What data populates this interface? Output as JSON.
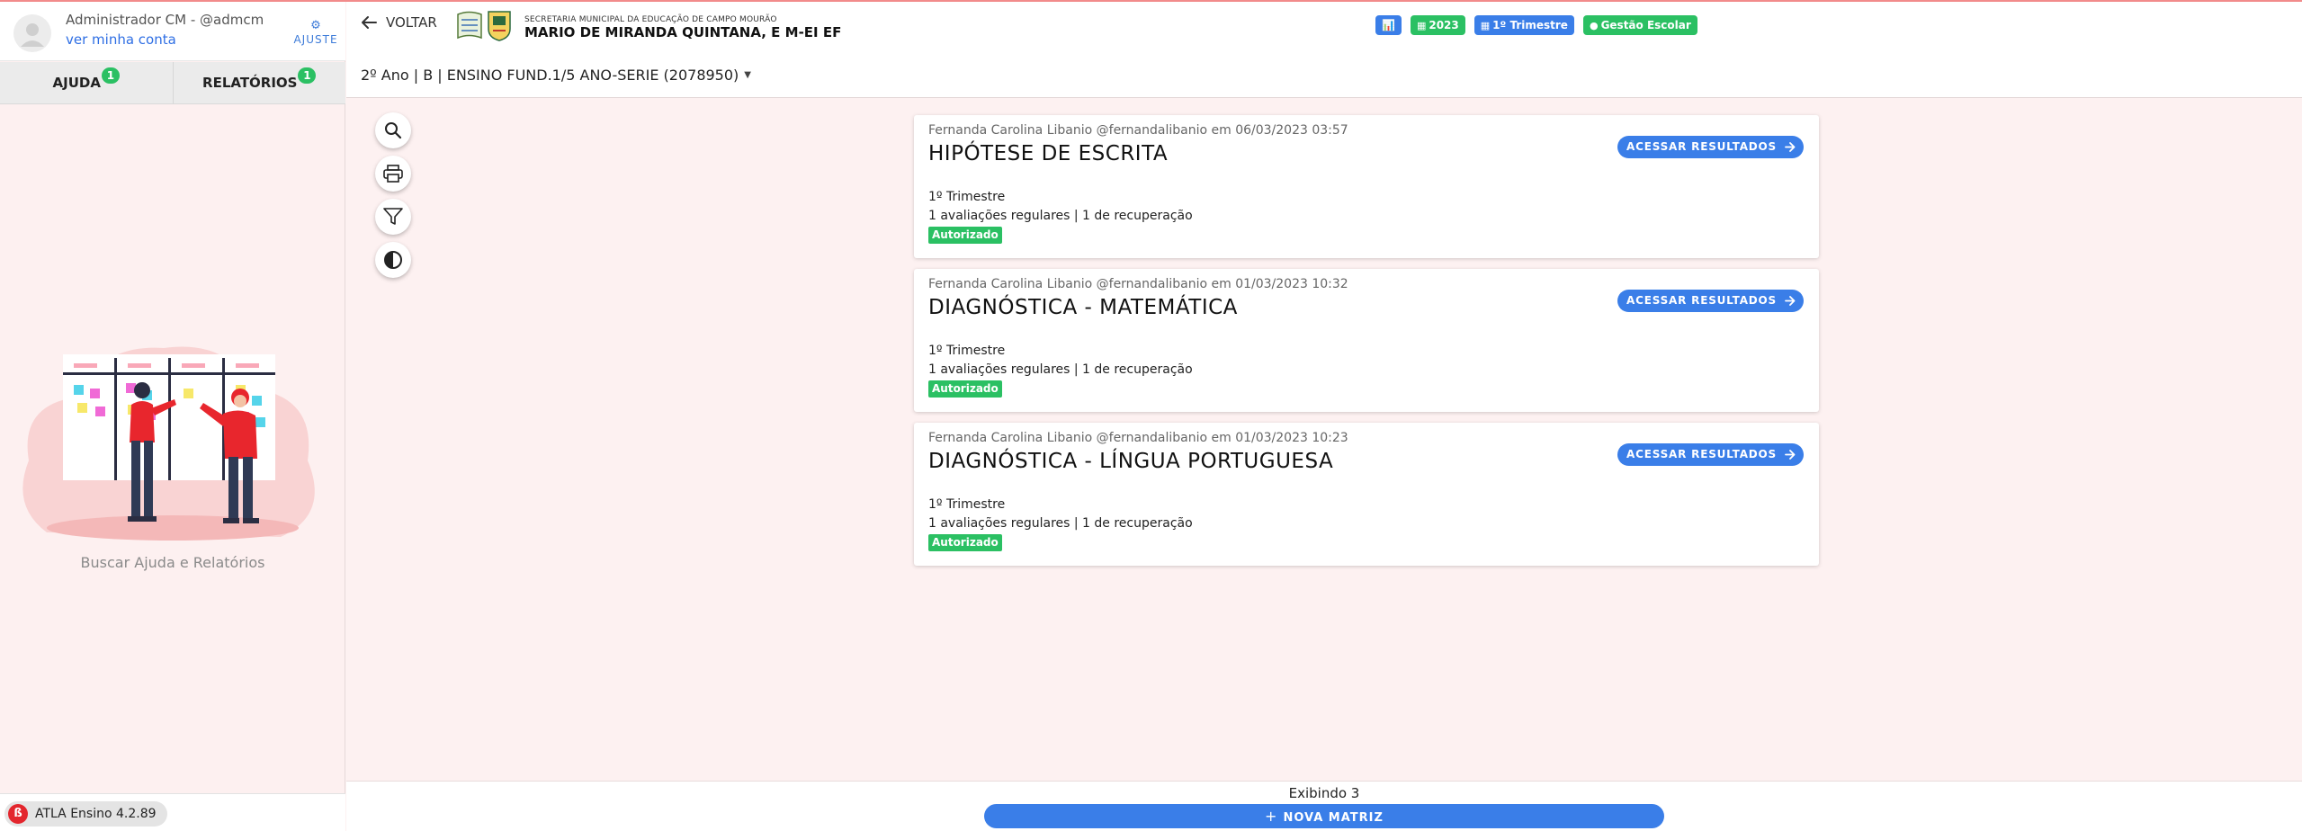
{
  "user": {
    "name": "Administrador CM - @admcm",
    "account_link": "ver minha conta",
    "adjust_label": "AJUSTE"
  },
  "sidebar": {
    "tabs": [
      {
        "label": "AJUDA",
        "badge": "1"
      },
      {
        "label": "RELATÓRIOS",
        "badge": "1"
      }
    ],
    "help_text": "Buscar Ajuda e Relatórios",
    "version": "ATLA Ensino 4.2.89"
  },
  "header": {
    "back_label": "VOLTAR",
    "org_subtitle": "SECRETARIA MUNICIPAL DA EDUCAÇÃO DE CAMPO MOURÃO",
    "org_title": "MARIO DE MIRANDA QUINTANA, E M-EI EF",
    "chips": {
      "year": "2023",
      "term": "1º Trimestre",
      "management": "Gestão Escolar"
    },
    "class_selector": "2º Ano | B | ENSINO FUND.1/5 ANO-SERIE (2078950)"
  },
  "tools": [
    "search-icon",
    "print-icon",
    "filter-icon",
    "contrast-icon"
  ],
  "cards": [
    {
      "meta": "Fernanda Carolina Libanio @fernandalibanio em 06/03/2023 03:57",
      "title": "HIPÓTESE DE ESCRITA",
      "term": "1º Trimestre",
      "evaluations": "1 avaliações regulares | 1 de recuperação",
      "status": "Autorizado",
      "action": "ACESSAR RESULTADOS"
    },
    {
      "meta": "Fernanda Carolina Libanio @fernandalibanio em 01/03/2023 10:32",
      "title": "DIAGNÓSTICA - MATEMÁTICA",
      "term": "1º Trimestre",
      "evaluations": "1 avaliações regulares | 1 de recuperação",
      "status": "Autorizado",
      "action": "ACESSAR RESULTADOS"
    },
    {
      "meta": "Fernanda Carolina Libanio @fernandalibanio em 01/03/2023 10:23",
      "title": "DIAGNÓSTICA - LÍNGUA PORTUGUESA",
      "term": "1º Trimestre",
      "evaluations": "1 avaliações regulares | 1 de recuperação",
      "status": "Autorizado",
      "action": "ACESSAR RESULTADOS"
    }
  ],
  "footer": {
    "showing": "Exibindo 3",
    "new_button": "NOVA MATRIZ"
  },
  "colors": {
    "primary": "#3a7ee8",
    "success": "#2bc063",
    "background": "#fdf1f1"
  }
}
